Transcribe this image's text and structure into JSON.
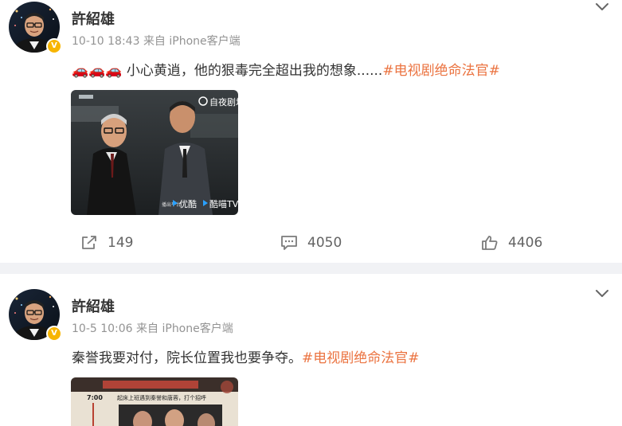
{
  "posts": [
    {
      "username": "許紹雄",
      "time": "10-10 18:43",
      "source": "来自 iPhone客户端",
      "text_prefix": "🚗🚗🚗 小心黄逍，他的狠毒完全超出我的想象......",
      "hashtag": "#电视剧绝命法官#",
      "media": {
        "logo_text": "自夜剧场",
        "watermark_platform_label": "播出平台",
        "watermark_youku": "优酷",
        "watermark_kumiao": "酷喵TV"
      },
      "actions": {
        "repost_count": "149",
        "comment_count": "4050",
        "like_count": "4406"
      }
    },
    {
      "username": "許紹雄",
      "time": "10-5 10:06",
      "source": "来自 iPhone客户端",
      "text_prefix": "秦誉我要对付，院长位置我也要争夺。",
      "hashtag": "#电视剧绝命法官#",
      "media": {
        "time_label": "7:00",
        "caption": "起床上班遇到秦誉和唐蓉，打个招呼"
      }
    }
  ],
  "colors": {
    "hashtag": "#eb7340",
    "meta": "#939393",
    "divider": "#f1f2f5",
    "verified": "#f7b500"
  },
  "icons": {
    "verified": "verified-badge-icon",
    "menu": "chevron-down-icon",
    "repost": "repost-icon",
    "comment": "comment-icon",
    "like": "thumbs-up-icon"
  }
}
